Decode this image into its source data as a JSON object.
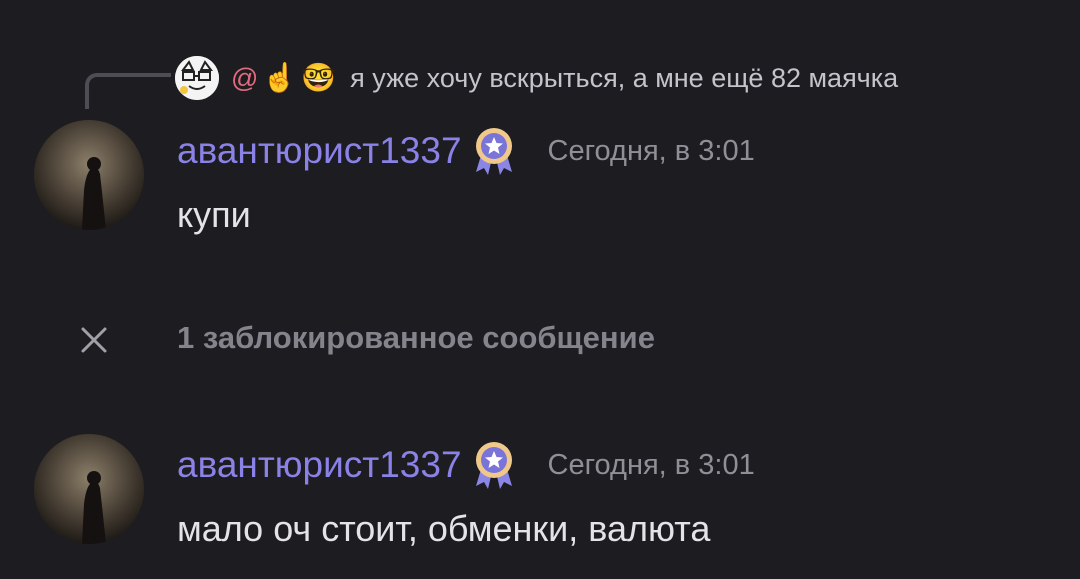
{
  "reply": {
    "author_mention": "@",
    "author_emojis": [
      "☝️",
      "🤓"
    ],
    "text": "я уже хочу вскрыться, а мне ещё 82 маячка"
  },
  "messages": [
    {
      "username": "авантюрист1337",
      "timestamp": "Сегодня, в 3:01",
      "text": "купи"
    },
    {
      "username": "авантюрист1337",
      "timestamp": "Сегодня, в 3:01",
      "text": "мало оч стоит, обменки, валюта"
    }
  ],
  "blocked": {
    "label": "1 заблокированное сообщение"
  },
  "colors": {
    "background": "#1c1c21",
    "username": "#8a82e6",
    "mention": "#e06a7e",
    "timestamp": "#8f9097"
  },
  "icons": {
    "badge": "badge-ribbon-icon",
    "blocked": "close-icon"
  }
}
